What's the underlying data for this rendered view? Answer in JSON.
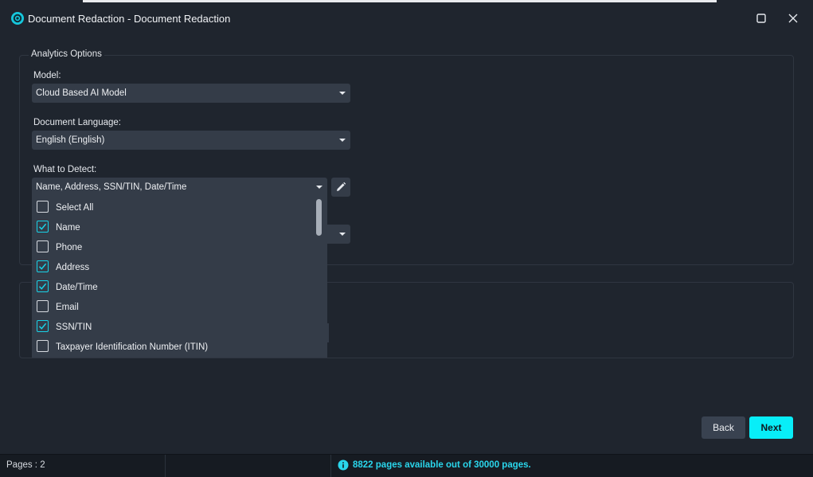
{
  "window": {
    "title": "Document Redaction - Document Redaction"
  },
  "analytics": {
    "legend": "Analytics Options",
    "model_label": "Model:",
    "model_value": "Cloud Based AI Model",
    "language_label": "Document Language:",
    "language_value": "English (English)",
    "detect_label": "What to Detect:",
    "detect_value": "Name, Address, SSN/TIN, Date/Time"
  },
  "detect_options": [
    {
      "label": "Select All",
      "checked": false
    },
    {
      "label": "Name",
      "checked": true
    },
    {
      "label": "Phone",
      "checked": false
    },
    {
      "label": "Address",
      "checked": true
    },
    {
      "label": "Date/Time",
      "checked": true
    },
    {
      "label": "Email",
      "checked": false
    },
    {
      "label": "SSN/TIN",
      "checked": true
    },
    {
      "label": "Taxpayer Identification Number (ITIN)",
      "checked": false
    }
  ],
  "buttons": {
    "back": "Back",
    "next": "Next"
  },
  "status": {
    "pages": "Pages : 2",
    "availability": "8822 pages available out of 30000 pages."
  },
  "colors": {
    "accent": "#08eef8",
    "background": "#1f252e",
    "control": "#343c48"
  },
  "icons": {
    "app": "app-logo-icon",
    "maximize": "maximize-icon",
    "close": "close-icon",
    "edit": "pencil-icon",
    "info": "info-icon"
  }
}
